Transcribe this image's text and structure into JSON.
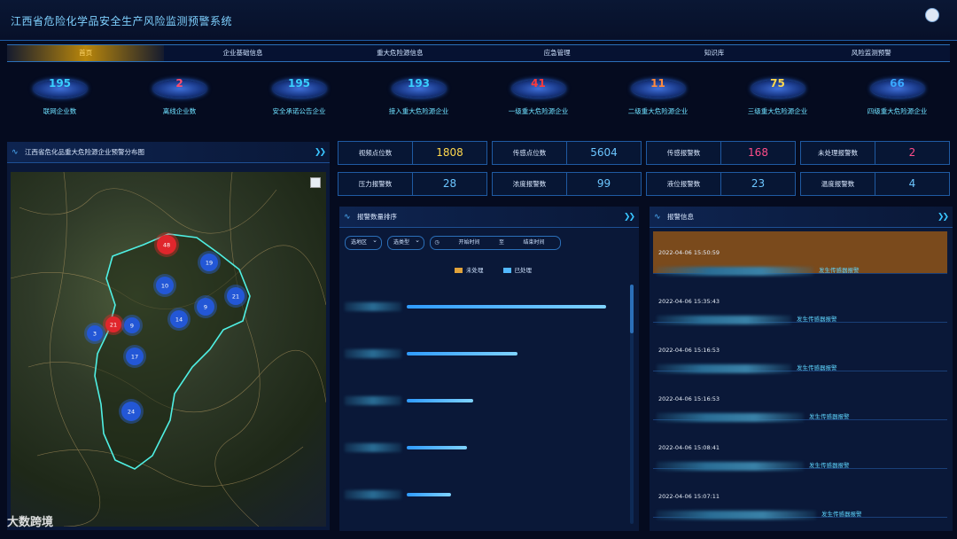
{
  "header": {
    "title": "江西省危险化学品安全生产风险监测预警系统"
  },
  "nav": [
    "首页",
    "企业基础信息",
    "重大危险源信息",
    "应急管理",
    "知识库",
    "风险监测预警"
  ],
  "stats": [
    {
      "value": "195",
      "label": "联网企业数",
      "color": "#39d0ff"
    },
    {
      "value": "2",
      "label": "离线企业数",
      "color": "#ff4d6d"
    },
    {
      "value": "195",
      "label": "安全承诺公告企业",
      "color": "#39d0ff"
    },
    {
      "value": "193",
      "label": "接入重大危险源企业",
      "color": "#39d0ff"
    },
    {
      "value": "41",
      "label": "一级重大危险源企业",
      "color": "#ff3b3b"
    },
    {
      "value": "11",
      "label": "二级重大危险源企业",
      "color": "#ff8a3d"
    },
    {
      "value": "75",
      "label": "三级重大危险源企业",
      "color": "#ffd84d"
    },
    {
      "value": "66",
      "label": "四级重大危险源企业",
      "color": "#39a8ff"
    }
  ],
  "map_panel": {
    "title": "江西省危化品重大危险源企业预警分布图",
    "clusters": [
      {
        "count": "48",
        "type": "red"
      },
      {
        "count": "19",
        "type": "blue"
      },
      {
        "count": "10",
        "type": "blue"
      },
      {
        "count": "21",
        "type": "blue"
      },
      {
        "count": "9",
        "type": "blue"
      },
      {
        "count": "14",
        "type": "blue"
      },
      {
        "count": "21",
        "type": "red"
      },
      {
        "count": "9",
        "type": "blue"
      },
      {
        "count": "3",
        "type": "blue"
      },
      {
        "count": "17",
        "type": "blue"
      },
      {
        "count": "24",
        "type": "blue"
      }
    ]
  },
  "metrics": [
    {
      "label": "视频点位数",
      "value": "1808",
      "color": "#ffd84d"
    },
    {
      "label": "传感点位数",
      "value": "5604",
      "color": "#6cc6ff"
    },
    {
      "label": "传感报警数",
      "value": "168",
      "color": "#ff4d8a"
    },
    {
      "label": "未处理报警数",
      "value": "2",
      "color": "#ff4d8a"
    },
    {
      "label": "压力报警数",
      "value": "28",
      "color": "#6cc6ff"
    },
    {
      "label": "浓度报警数",
      "value": "99",
      "color": "#6cc6ff"
    },
    {
      "label": "液位报警数",
      "value": "23",
      "color": "#6cc6ff"
    },
    {
      "label": "温度报警数",
      "value": "4",
      "color": "#6cc6ff"
    }
  ],
  "rank_panel": {
    "title": "报警数量排序",
    "filter_region": "选地区",
    "filter_type": "选类型",
    "date_start": "开始时间",
    "date_sep": "至",
    "date_end": "结束时间",
    "legend_unhandled": "未处理",
    "legend_handled": "已处理",
    "bars": [
      {
        "handled": 0.9
      },
      {
        "handled": 0.5
      },
      {
        "handled": 0.3
      },
      {
        "handled": 0.27
      },
      {
        "handled": 0.2
      }
    ]
  },
  "alarm_panel": {
    "title": "报警信息",
    "items": [
      {
        "time": "2022-04-06 15:50:59",
        "msg": "发生传感器报警"
      },
      {
        "time": "2022-04-06 15:35:43",
        "msg": "发生传感器报警"
      },
      {
        "time": "2022-04-06 15:16:53",
        "msg": "发生传感器报警"
      },
      {
        "time": "2022-04-06 15:16:53",
        "msg": "发生传感器报警"
      },
      {
        "time": "2022-04-06 15:08:41",
        "msg": "发生传感器报警"
      },
      {
        "time": "2022-04-06 15:07:11",
        "msg": "发生传感器报警"
      }
    ]
  },
  "watermark": "大数跨境"
}
